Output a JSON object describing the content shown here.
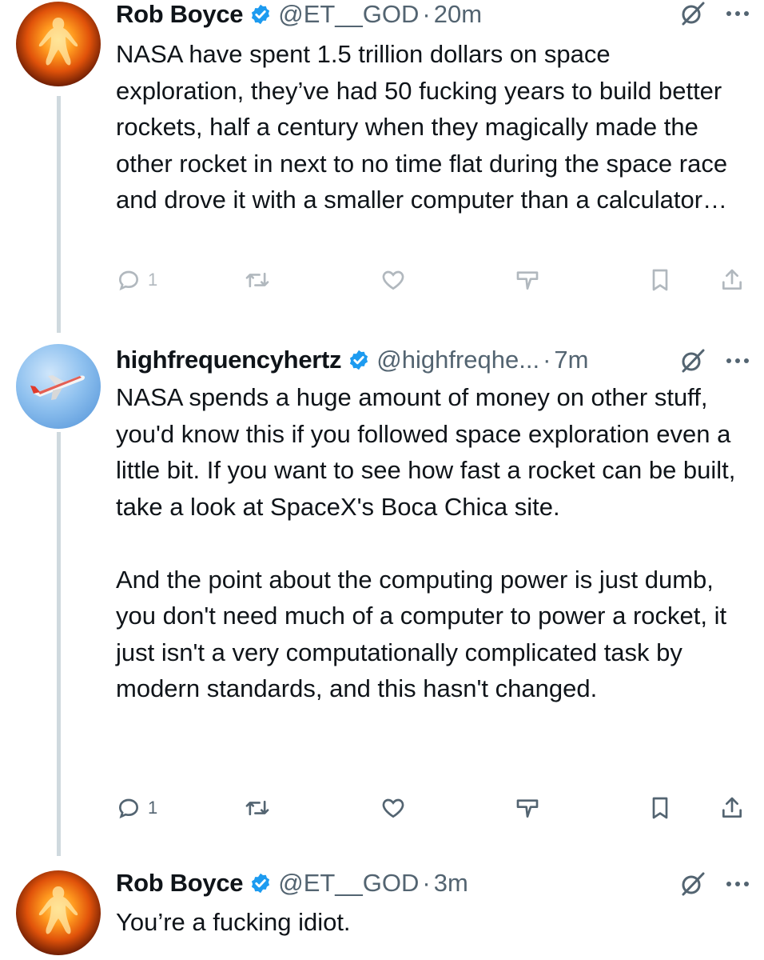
{
  "tweets": [
    {
      "name": "Rob Boyce",
      "handle": "@ET__GOD",
      "dot": "·",
      "time": "20m",
      "text": "NASA have spent 1.5 trillion dollars on space exploration, they’ve had 50 fucking years to build better rockets, half a century when they magically made the other rocket in next to no time flat during the space race and drove it with a smaller computer than a calculator…",
      "reply_count": "1",
      "avatar_icon": "fire-figure-avatar"
    },
    {
      "name": "highfrequencyhertz",
      "handle": "@highfreqhe...",
      "dot": "·",
      "time": "7m",
      "text": "NASA spends a huge amount of money on other stuff, you'd know this if you followed space exploration even a little bit. If you want to see how fast a rocket can be built, take a look at SpaceX's Boca Chica site.\n\nAnd the point about the computing power is just dumb, you don't need much of a computer to power a rocket, it just isn't a very computationally complicated task by modern standards, and this hasn't changed.",
      "reply_count": "1",
      "avatar_icon": "airplane-avatar"
    },
    {
      "name": "Rob Boyce",
      "handle": "@ET__GOD",
      "dot": "·",
      "time": "3m",
      "text": "You’re a fucking idiot.",
      "avatar_icon": "fire-figure-avatar"
    }
  ],
  "colors": {
    "text": "#0f1419",
    "secondary": "#536471",
    "verified": "#1d9bf0",
    "thread_line": "#cfd9de"
  }
}
